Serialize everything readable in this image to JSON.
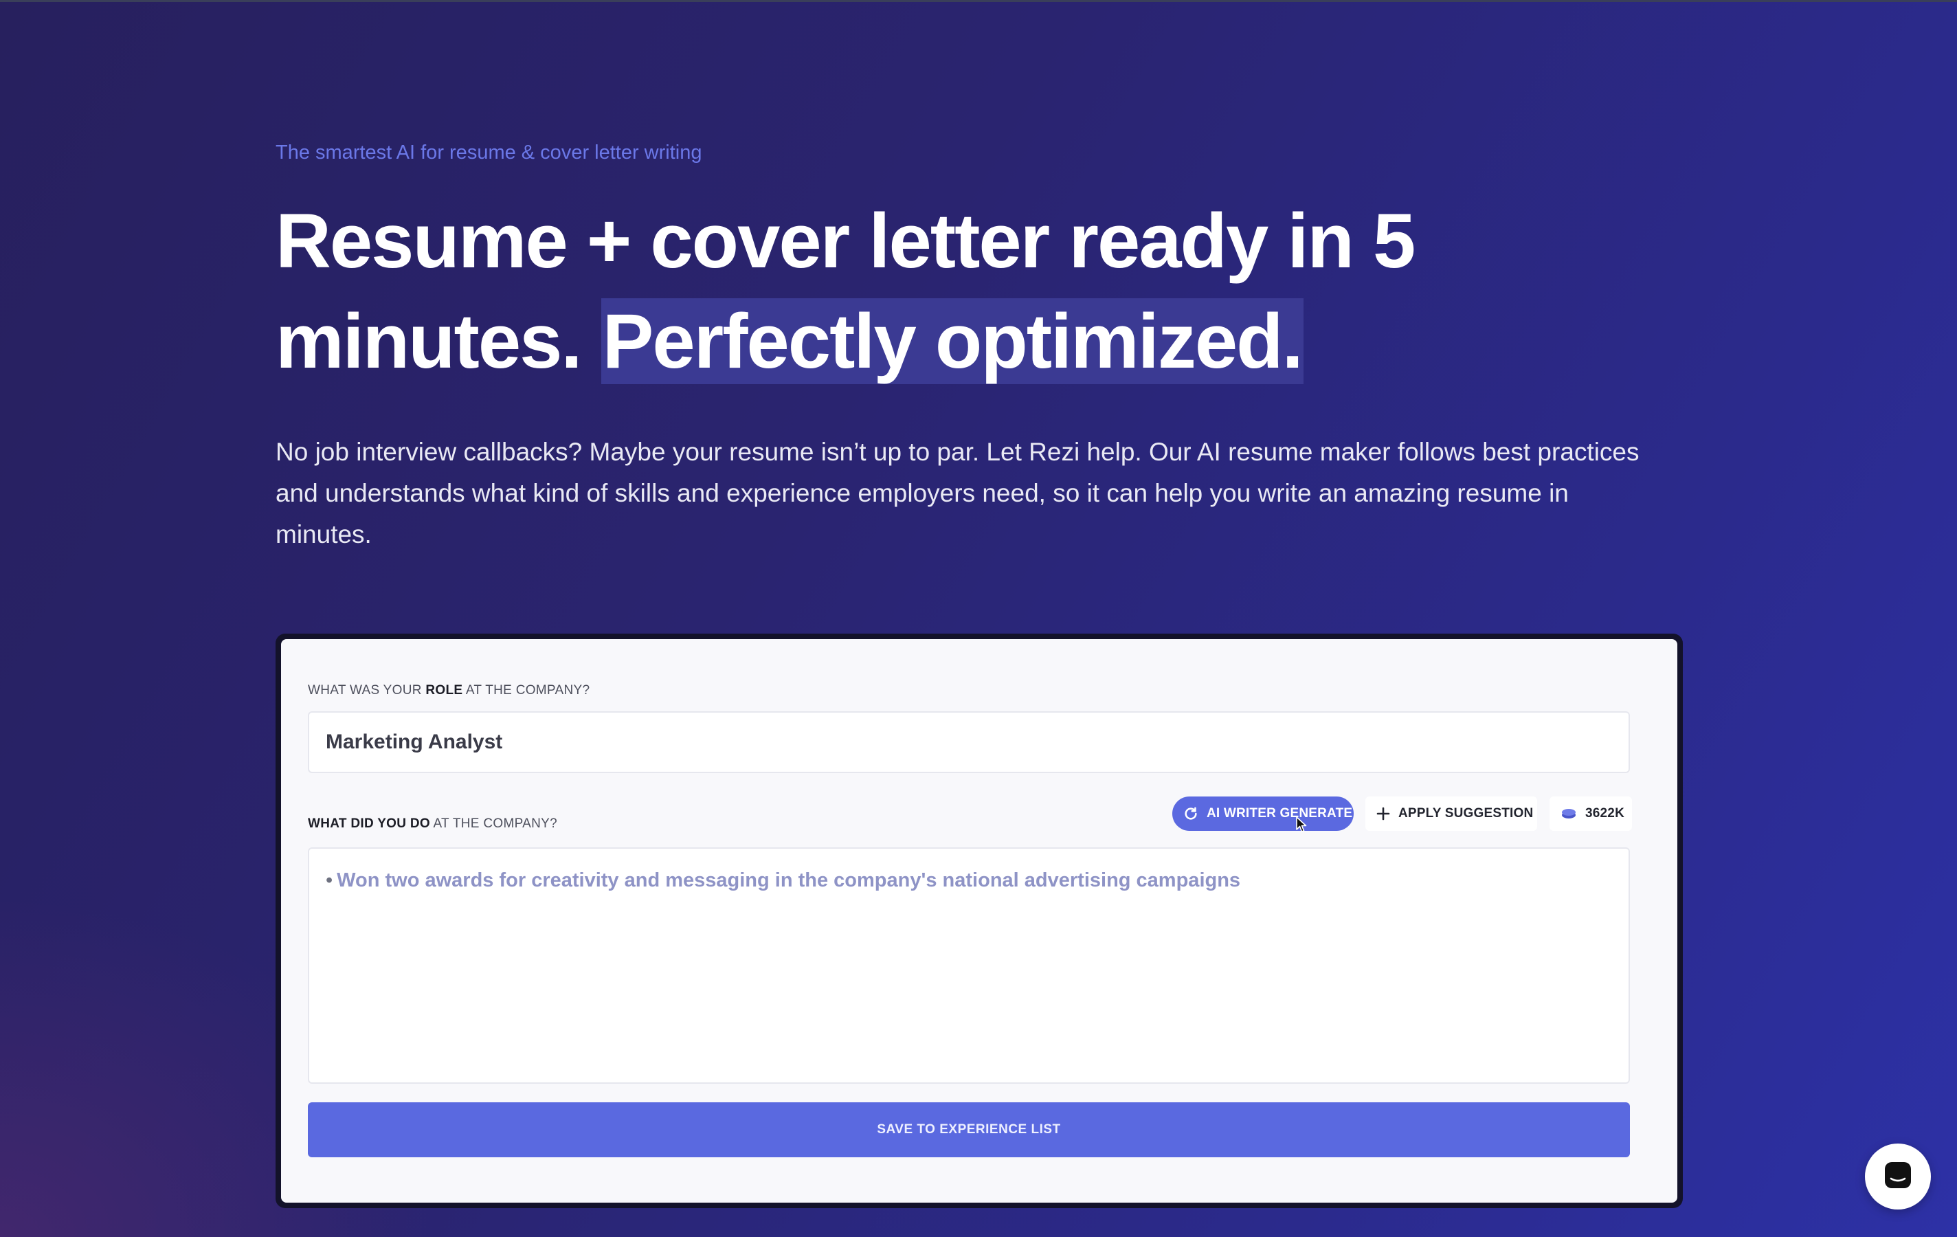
{
  "hero": {
    "tagline": "The smartest AI for resume & cover letter writing",
    "headline_part1": "Resume + cover letter ready in 5 minutes. ",
    "headline_highlight": "Perfectly optimized.",
    "subtext": "No job interview callbacks? Maybe your resume isn’t up to par. Let Rezi help. Our AI resume maker follows best practices and understands what kind of skills and experience employers need, so it can help you write an amazing resume in minutes."
  },
  "form": {
    "role_label_pre": "What was your ",
    "role_label_bold": "Role",
    "role_label_post": " at the company?",
    "role_value": "Marketing Analyst",
    "do_label_bold": "What did you do",
    "do_label_post": " at the company?",
    "ai_button_label": "AI WRITER GENERATE",
    "apply_button_label": "APPLY SUGGESTION",
    "credits_label": "3622K",
    "bullet_text": "Won two awards for creativity and messaging in the company's national advertising campaigns",
    "save_button_label": "SAVE TO EXPERIENCE LIST"
  },
  "colors": {
    "accent": "#5b69e0",
    "tagline": "#6b78e8",
    "highlight": "#3b3a93",
    "suggestion_text": "#8e93c6"
  },
  "icons": {
    "ai_button": "refresh-icon",
    "apply_button": "plus-icon",
    "credits": "coin-stack-icon",
    "chat": "chat-icon"
  }
}
